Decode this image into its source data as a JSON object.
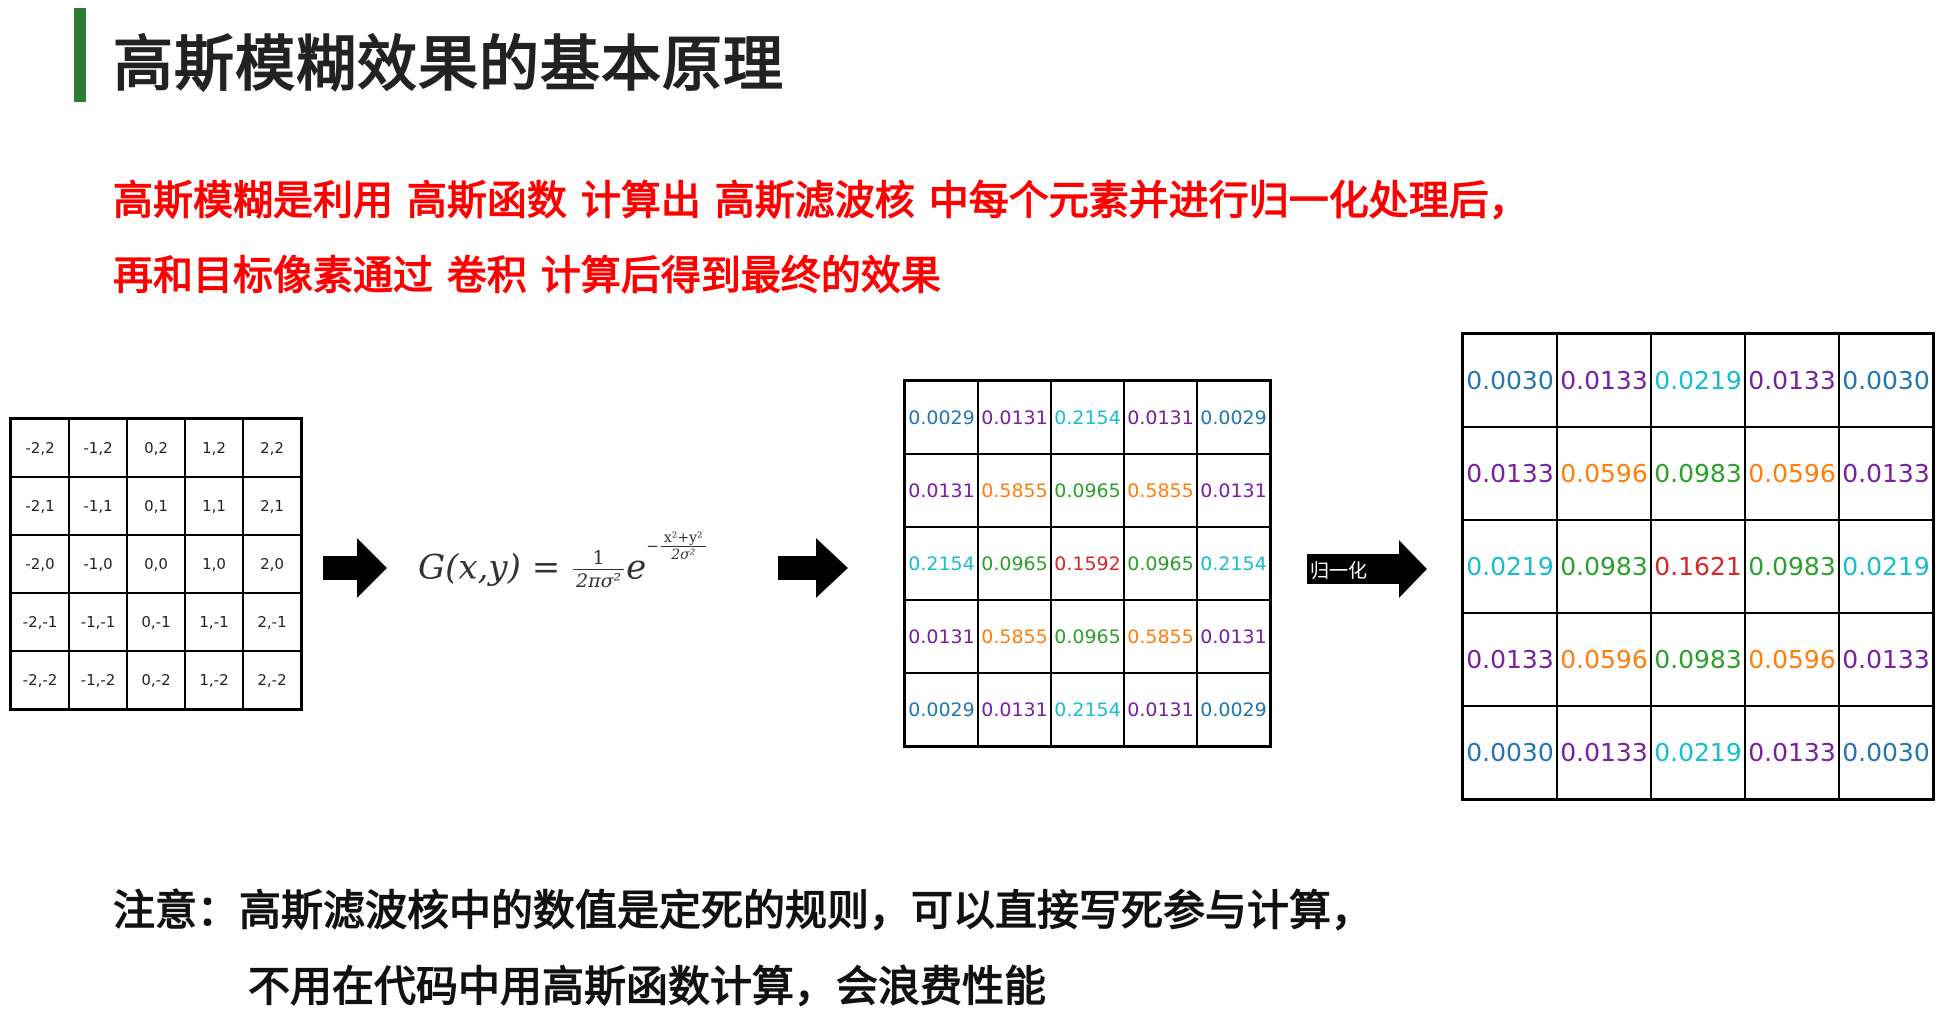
{
  "title": "高斯模糊效果的基本原理",
  "description": {
    "line1": "高斯模糊是利用 高斯函数 计算出 高斯滤波核 中每个元素并进行归一化处理后，",
    "line2": "再和目标像素通过 卷积 计算后得到最终的效果"
  },
  "coordinate_grid": [
    [
      "-2,2",
      "-1,2",
      "0,2",
      "1,2",
      "2,2"
    ],
    [
      "-2,1",
      "-1,1",
      "0,1",
      "1,1",
      "2,1"
    ],
    [
      "-2,0",
      "-1,0",
      "0,0",
      "1,0",
      "2,0"
    ],
    [
      "-2,-1",
      "-1,-1",
      "0,-1",
      "1,-1",
      "2,-1"
    ],
    [
      "-2,-2",
      "-1,-2",
      "0,-2",
      "1,-2",
      "2,-2"
    ]
  ],
  "formula": {
    "lhs": "G(x,y) =",
    "coef_num": "1",
    "coef_den": "2πσ²",
    "base": "e",
    "exp_sign": "−",
    "exp_num": "x²+y²",
    "exp_den": "2σ²"
  },
  "kernel_grid": [
    [
      "0.0029",
      "0.0131",
      "0.2154",
      "0.0131",
      "0.0029"
    ],
    [
      "0.0131",
      "0.5855",
      "0.0965",
      "0.5855",
      "0.0131"
    ],
    [
      "0.2154",
      "0.0965",
      "0.1592",
      "0.0965",
      "0.2154"
    ],
    [
      "0.0131",
      "0.5855",
      "0.0965",
      "0.5855",
      "0.0131"
    ],
    [
      "0.0029",
      "0.0131",
      "0.2154",
      "0.0131",
      "0.0029"
    ]
  ],
  "normalize_label": "归一化",
  "normalized_grid": [
    [
      "0.0030",
      "0.0133",
      "0.0219",
      "0.0133",
      "0.0030"
    ],
    [
      "0.0133",
      "0.0596",
      "0.0983",
      "0.0596",
      "0.0133"
    ],
    [
      "0.0219",
      "0.0983",
      "0.1621",
      "0.0983",
      "0.0219"
    ],
    [
      "0.0133",
      "0.0596",
      "0.0983",
      "0.0596",
      "0.0133"
    ],
    [
      "0.0030",
      "0.0133",
      "0.0219",
      "0.0133",
      "0.0030"
    ]
  ],
  "value_colors": {
    "0.0029": "#1f77b4",
    "0.0030": "#1f77b4",
    "0.0131": "#7b1fa2",
    "0.0133": "#7b1fa2",
    "0.2154": "#17becf",
    "0.0219": "#17becf",
    "0.5855": "#ff7f0e",
    "0.0596": "#ff7f0e",
    "0.0965": "#2ca02c",
    "0.0983": "#2ca02c",
    "0.1592": "#d62728",
    "0.1621": "#d62728"
  },
  "note": {
    "line1": "注意：高斯滤波核中的数值是定死的规则，可以直接写死参与计算，",
    "line2": "不用在代码中用高斯函数计算，会浪费性能"
  }
}
